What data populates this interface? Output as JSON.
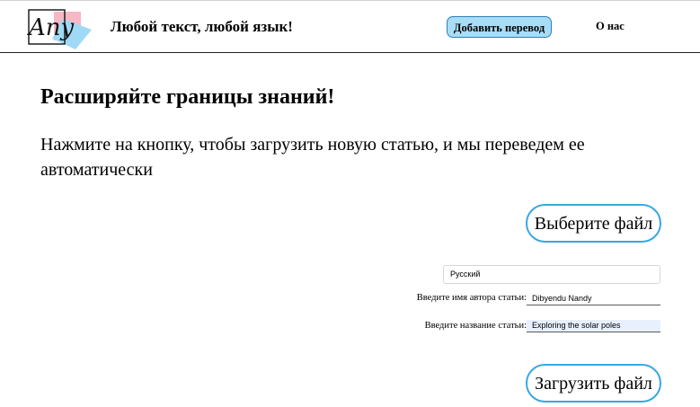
{
  "header": {
    "logo_text": "Any",
    "tagline": "Любой текст, любой язык!",
    "add_translation_label": "Добавить перевод",
    "about_label": "О нас"
  },
  "main": {
    "headline": "Расширяйте границы знаний!",
    "description": "Нажмите на кнопку, чтобы загрузить новую статью, и мы переведем ее автоматически",
    "choose_file_label": "Выберите файл",
    "language_value": "Русский",
    "author_label": "Введите имя автора статьи:",
    "author_value": "Dibyendu Nandy",
    "title_label": "Введите название статьи:",
    "title_value": "Exploring the solar poles",
    "upload_label": "Загрузить файл"
  },
  "colors": {
    "accent_blue": "#3aa7e0",
    "button_fill": "#a9ddf6",
    "logo_pink": "#f6b8c4",
    "logo_blue": "#9fd9f5",
    "autofill_bg": "#e8f0fe"
  }
}
